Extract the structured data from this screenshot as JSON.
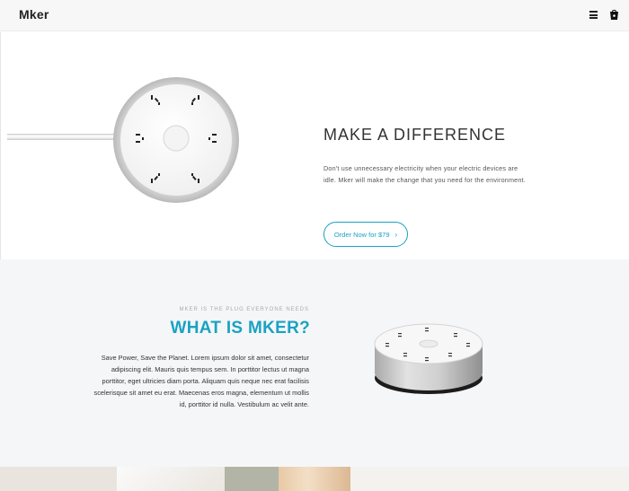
{
  "header": {
    "logo": "Mker",
    "icons": [
      "menu-icon",
      "cart-icon"
    ]
  },
  "hero": {
    "title": "MAKE A DIFFERENCE",
    "description": "Don't use unnecessary electricity when your electric devices are idle. Mker will make the change that you need for the environment.",
    "cta_label": "Order Now for $79",
    "cta_icon": "chevron-right-icon"
  },
  "about": {
    "eyebrow": "MKER IS THE PLUG EVERYONE NEEDS",
    "title": "WHAT IS MKER?",
    "body": "Save Power, Save the Planet. Lorem ipsum dolor sit amet, consectetur adipiscing elit. Mauris quis tempus sem. In porttitor lectus ut magna porttitor, eget ultricies diam porta. Aliquam quis neque nec erat facilisis scelerisque sit amet eu erat. Maecenas eros magna, elementum ut mollis id, porttitor id nulla. Vestibulum ac velit ante."
  },
  "colors": {
    "accent": "#1aa2c2",
    "header_bg": "#f7f7f7",
    "section_bg": "#f5f6f8"
  }
}
